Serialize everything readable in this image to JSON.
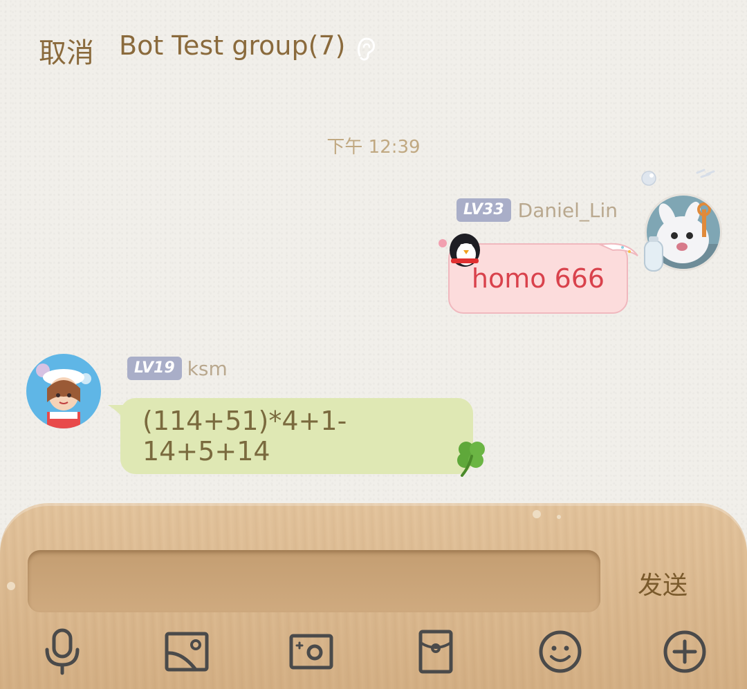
{
  "header": {
    "cancel_label": "取消",
    "title": "Bot Test group(7)",
    "mode_icon": "ear-icon"
  },
  "timestamp": "下午 12:39",
  "messages": [
    {
      "side": "right",
      "level": "LV33",
      "sender": "Daniel_Lin",
      "text": "homo 666",
      "bubble_color": "#fcdcdc",
      "text_color": "#d9424c"
    },
    {
      "side": "left",
      "level": "LV19",
      "sender": "ksm",
      "text": "(114+51)*4+1-14+5+14",
      "bubble_color": "#dfe8b4",
      "text_color": "#7a6a3e"
    }
  ],
  "input": {
    "value": "",
    "send_label": "发送"
  },
  "toolbar": {
    "icons": [
      "microphone-icon",
      "image-icon",
      "camera-icon",
      "red-packet-icon",
      "emoji-icon",
      "plus-icon"
    ]
  },
  "colors": {
    "accent_text": "#8a6a3c",
    "level_badge": "#a9aec8"
  }
}
